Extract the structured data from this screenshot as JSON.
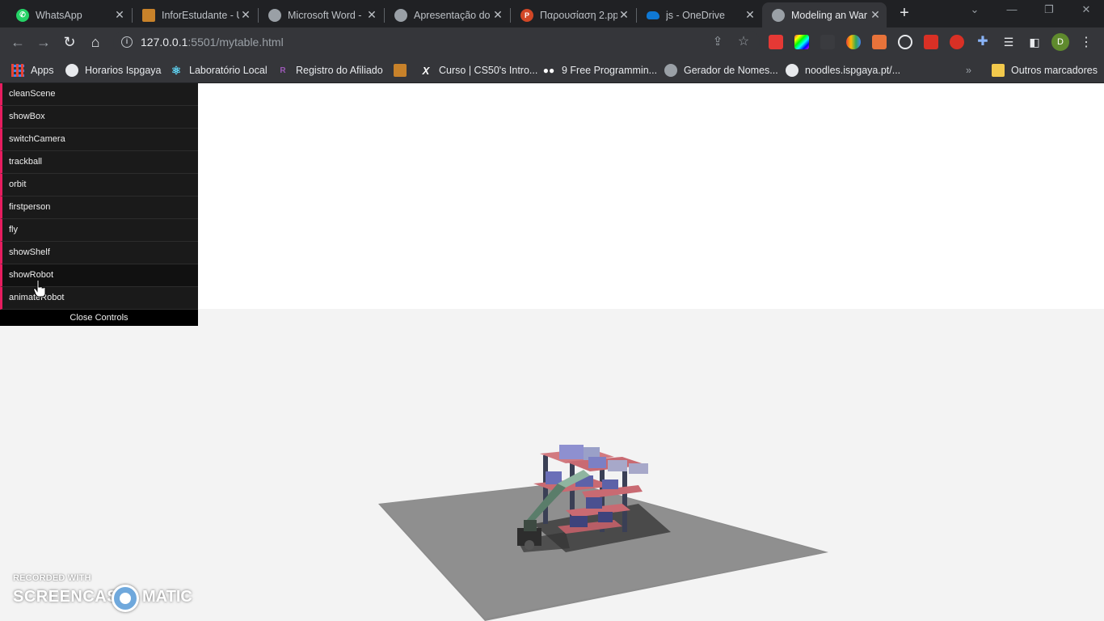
{
  "browser": {
    "tabs": [
      {
        "title": "WhatsApp",
        "icon": "whatsapp-icon",
        "color": "#25d366",
        "active": false
      },
      {
        "title": "InforEstudante - U",
        "icon": "inforestudante-icon",
        "color": "#c8822a",
        "active": false
      },
      {
        "title": "Microsoft Word -",
        "icon": "globe-icon",
        "color": "#9aa0a6",
        "active": false
      },
      {
        "title": "Apresentação do",
        "icon": "globe-icon",
        "color": "#9aa0a6",
        "active": false
      },
      {
        "title": "Παρουσίαση 2.pp",
        "icon": "powerpoint-icon",
        "color": "#d24726",
        "active": false
      },
      {
        "title": "js - OneDrive",
        "icon": "onedrive-icon",
        "color": "#0f78d4",
        "active": false
      },
      {
        "title": "Modeling an War",
        "icon": "globe-icon",
        "color": "#9aa0a6",
        "active": true
      }
    ],
    "url_host": "127.0.0.1",
    "url_path": ":5501/mytable.html",
    "profile_initial": "D",
    "bookmarks": [
      {
        "label": "Apps",
        "icon": "apps-grid-icon",
        "color": "#4285f4"
      },
      {
        "label": "Horarios Ispgaya",
        "icon": "globe-icon",
        "color": "#e8eaed"
      },
      {
        "label": "Laboratório Local",
        "icon": "react-icon",
        "color": "#61dafb"
      },
      {
        "label": "Registro do Afiliado",
        "icon": "registro-icon",
        "color": "#7b3fa0"
      },
      {
        "label": "",
        "icon": "inforestudante-icon",
        "color": "#c8822a"
      },
      {
        "label": "Curso | CS50's Intro...",
        "icon": "x-icon",
        "color": "#ffffff"
      },
      {
        "label": "9 Free Programmin...",
        "icon": "medium-icon",
        "color": "#ffffff"
      },
      {
        "label": "Gerador de Nomes...",
        "icon": "gerador-icon",
        "color": "#9aa0a6"
      },
      {
        "label": "noodles.ispgaya.pt/...",
        "icon": "globe-icon",
        "color": "#e8eaed"
      }
    ],
    "other_bookmarks": "Outros marcadores"
  },
  "gui": {
    "controls": [
      "cleanScene",
      "showBox",
      "switchCamera",
      "trackball",
      "orbit",
      "firstperson",
      "fly",
      "showShelf",
      "showRobot",
      "animateRobot"
    ],
    "close_label": "Close Controls",
    "accent": "#e61d5f"
  },
  "watermark": {
    "top": "RECORDED WITH",
    "left": "SCREENCAST",
    "right": "MATIC"
  }
}
